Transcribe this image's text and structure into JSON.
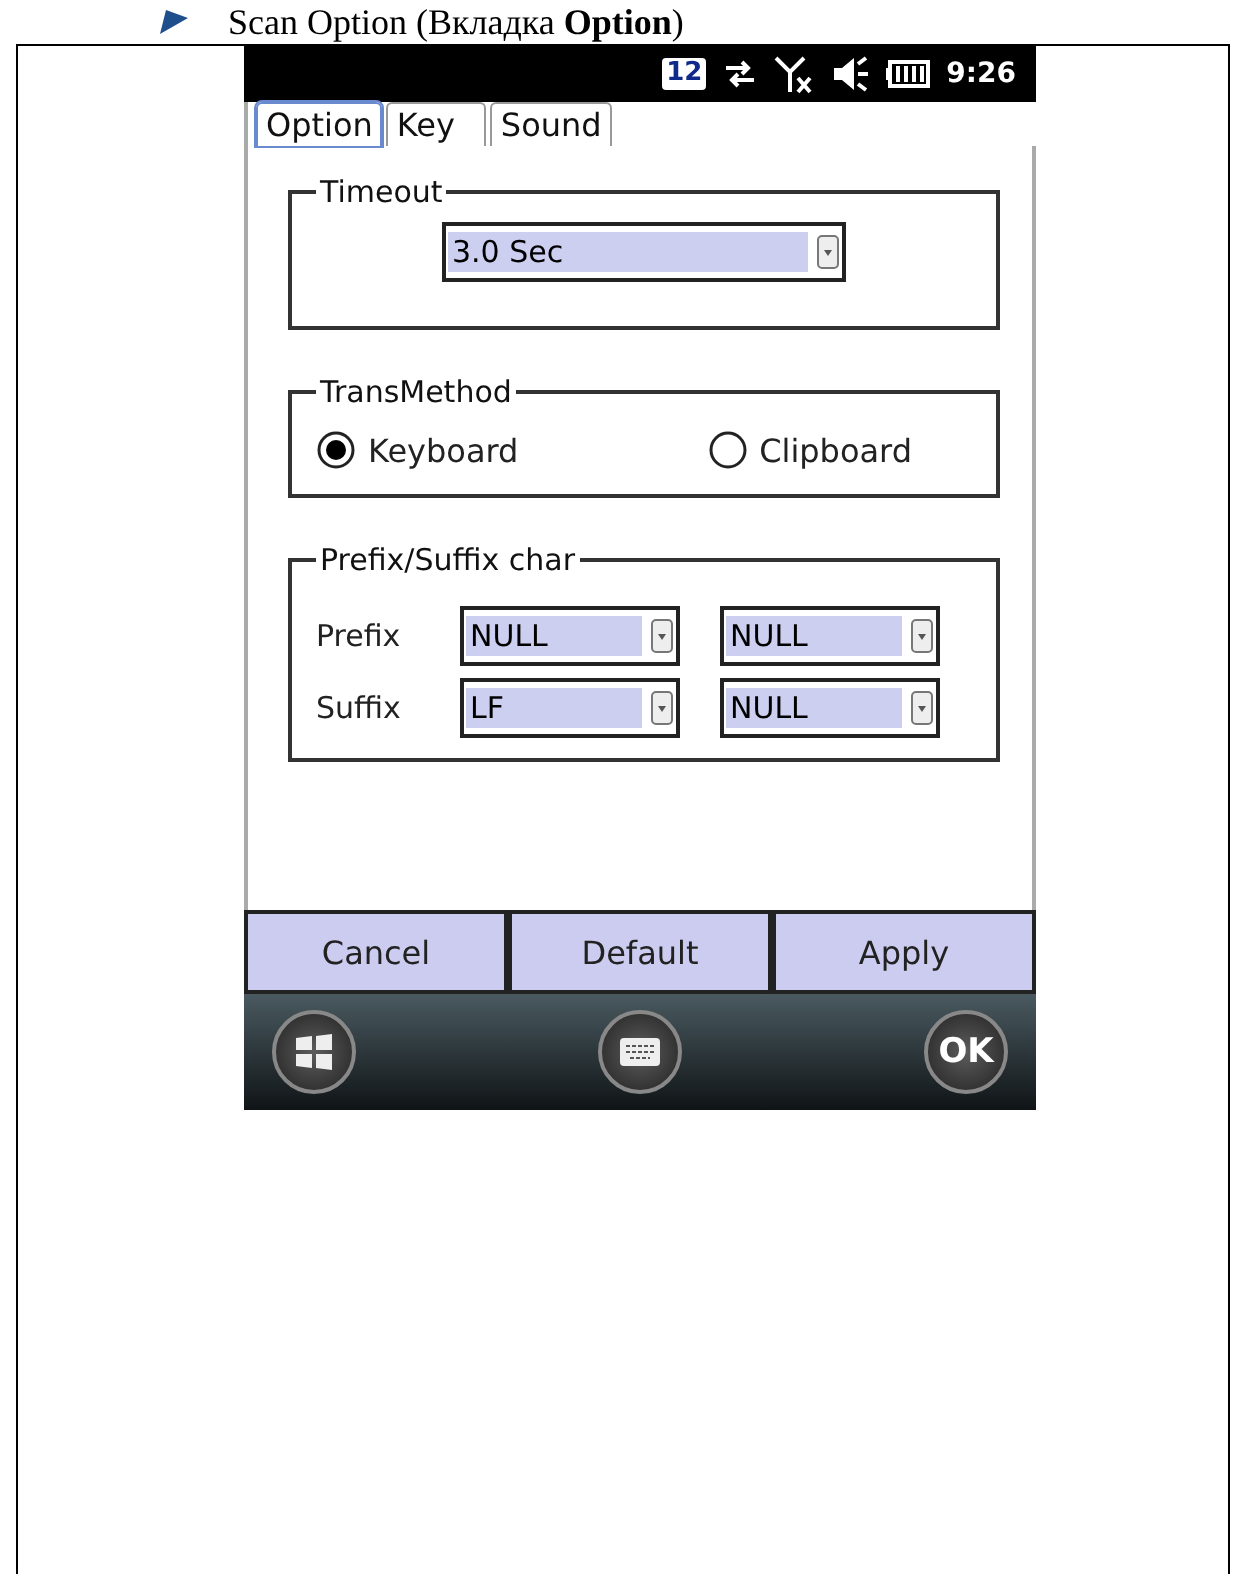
{
  "heading": {
    "text": "Scan Option (Вкладка **Option**)"
  },
  "status_bar": {
    "badge": "12",
    "time": "9:26"
  },
  "tabs": [
    {
      "label": "Option",
      "selected": true
    },
    {
      "label": "Key",
      "selected": false
    },
    {
      "label": "Sound",
      "selected": false
    }
  ],
  "timeout": {
    "title": "Timeout",
    "value": "3.0 Sec"
  },
  "trans_method": {
    "title": "TransMethod",
    "options": [
      {
        "label": "Keyboard",
        "selected": true
      },
      {
        "label": "Clipboard",
        "selected": false
      }
    ]
  },
  "prefix_suffix": {
    "title": "Prefix/Suffix char",
    "rows": [
      {
        "label": "Prefix",
        "values": [
          "NULL",
          "NULL"
        ]
      },
      {
        "label": "Suffix",
        "values": [
          "LF",
          "NULL"
        ]
      }
    ]
  },
  "buttons": [
    "Cancel",
    "Default",
    "Apply"
  ],
  "taskbar": {
    "ok": "OK"
  }
}
